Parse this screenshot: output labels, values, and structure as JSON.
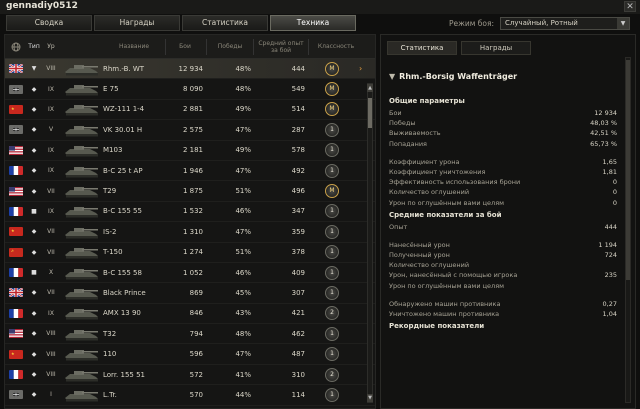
{
  "window": {
    "title": "gennadiy0512",
    "close_glyph": "✕"
  },
  "tabs": [
    "Сводка",
    "Награды",
    "Статистика",
    "Техника"
  ],
  "active_tab": 3,
  "mode": {
    "label": "Режим боя:",
    "value": "Случайный, Ротный"
  },
  "table": {
    "headers": {
      "nation": "",
      "type": "Тип",
      "tier": "Ур",
      "name": "Название",
      "battles": "Бои",
      "wins": "Победы",
      "exp": "Средний опыт за бой",
      "class": "Классность"
    },
    "rows": [
      {
        "nation": "uk",
        "type": "▼",
        "tier": "VIII",
        "name": "Rhm.-B. WT",
        "battles": "12 934",
        "wins": "48%",
        "exp": "444",
        "class": "M",
        "selected": true
      },
      {
        "nation": "de",
        "type": "◆",
        "tier": "IX",
        "name": "E 75",
        "battles": "8 090",
        "wins": "48%",
        "exp": "549",
        "class": "M"
      },
      {
        "nation": "cn",
        "type": "◆",
        "tier": "IX",
        "name": "WZ-111 1-4",
        "battles": "2 881",
        "wins": "49%",
        "exp": "514",
        "class": "M"
      },
      {
        "nation": "de",
        "type": "◆",
        "tier": "V",
        "name": "VK 30.01 H",
        "battles": "2 575",
        "wins": "47%",
        "exp": "287",
        "class": "1"
      },
      {
        "nation": "us",
        "type": "◆",
        "tier": "IX",
        "name": "M103",
        "battles": "2 181",
        "wins": "49%",
        "exp": "578",
        "class": "1"
      },
      {
        "nation": "fr",
        "type": "◆",
        "tier": "IX",
        "name": "B-C 25 t AP",
        "battles": "1 946",
        "wins": "47%",
        "exp": "492",
        "class": "1"
      },
      {
        "nation": "us",
        "type": "◆",
        "tier": "VII",
        "name": "T29",
        "battles": "1 875",
        "wins": "51%",
        "exp": "496",
        "class": "M"
      },
      {
        "nation": "fr",
        "type": "■",
        "tier": "IX",
        "name": "B-C 155 55",
        "battles": "1 532",
        "wins": "46%",
        "exp": "347",
        "class": "1"
      },
      {
        "nation": "cn",
        "type": "◆",
        "tier": "VII",
        "name": "IS-2",
        "battles": "1 310",
        "wins": "47%",
        "exp": "359",
        "class": "1"
      },
      {
        "nation": "su",
        "type": "◆",
        "tier": "VII",
        "name": "T-150",
        "battles": "1 274",
        "wins": "51%",
        "exp": "378",
        "class": "1"
      },
      {
        "nation": "fr",
        "type": "■",
        "tier": "X",
        "name": "B-C 155 58",
        "battles": "1 052",
        "wins": "46%",
        "exp": "409",
        "class": "1"
      },
      {
        "nation": "uk",
        "type": "◆",
        "tier": "VII",
        "name": "Black Prince",
        "battles": "869",
        "wins": "45%",
        "exp": "307",
        "class": "1"
      },
      {
        "nation": "fr",
        "type": "◆",
        "tier": "IX",
        "name": "AMX 13 90",
        "battles": "846",
        "wins": "43%",
        "exp": "421",
        "class": "2"
      },
      {
        "nation": "us",
        "type": "◆",
        "tier": "VIII",
        "name": "T32",
        "battles": "794",
        "wins": "48%",
        "exp": "462",
        "class": "1"
      },
      {
        "nation": "cn",
        "type": "◆",
        "tier": "VIII",
        "name": "110",
        "battles": "596",
        "wins": "47%",
        "exp": "487",
        "class": "1"
      },
      {
        "nation": "fr",
        "type": "◆",
        "tier": "VIII",
        "name": "Lorr. 155 51",
        "battles": "572",
        "wins": "41%",
        "exp": "310",
        "class": "2"
      },
      {
        "nation": "de",
        "type": "◆",
        "tier": "I",
        "name": "L.Tr.",
        "battles": "570",
        "wins": "44%",
        "exp": "114",
        "class": "1"
      }
    ]
  },
  "detail": {
    "tabs": [
      "Статистика",
      "Награды"
    ],
    "vehicle": "Rhm.-Borsig Waffenträger",
    "sections": [
      {
        "title": "Общие параметры",
        "stats": [
          {
            "label": "Бои",
            "value": "12 934"
          },
          {
            "label": "Победы",
            "value": "48,03 %"
          },
          {
            "label": "Выживаемость",
            "value": "42,51 %"
          },
          {
            "label": "Попадания",
            "value": "65,73 %"
          }
        ]
      },
      {
        "title": "",
        "stats": [
          {
            "label": "Коэффициент урона",
            "value": "1,65"
          },
          {
            "label": "Коэффициент уничтожения",
            "value": "1,81"
          },
          {
            "label": "Эффективность использования брони",
            "value": "0"
          },
          {
            "label": "Количество оглушений",
            "value": "0"
          },
          {
            "label": "Урон по оглушённым вами целям",
            "value": "0"
          }
        ]
      },
      {
        "title": "Средние показатели за бой",
        "stats": [
          {
            "label": "Опыт",
            "value": "444"
          }
        ]
      },
      {
        "title": "",
        "stats": [
          {
            "label": "Нанесённый урон",
            "value": "1 194"
          },
          {
            "label": "Полученный урон",
            "value": "724"
          },
          {
            "label": "Количество оглушений",
            "value": ""
          },
          {
            "label": "Урон, нанесённый с помощью игрока",
            "value": "235"
          },
          {
            "label": "Урон по оглушённым вами целям",
            "value": ""
          }
        ]
      },
      {
        "title": "",
        "stats": [
          {
            "label": "Обнаружено машин противника",
            "value": "0,27"
          },
          {
            "label": "Уничтожено машин противника",
            "value": "1,04"
          }
        ]
      },
      {
        "title": "Рекордные показатели",
        "stats": []
      }
    ]
  }
}
